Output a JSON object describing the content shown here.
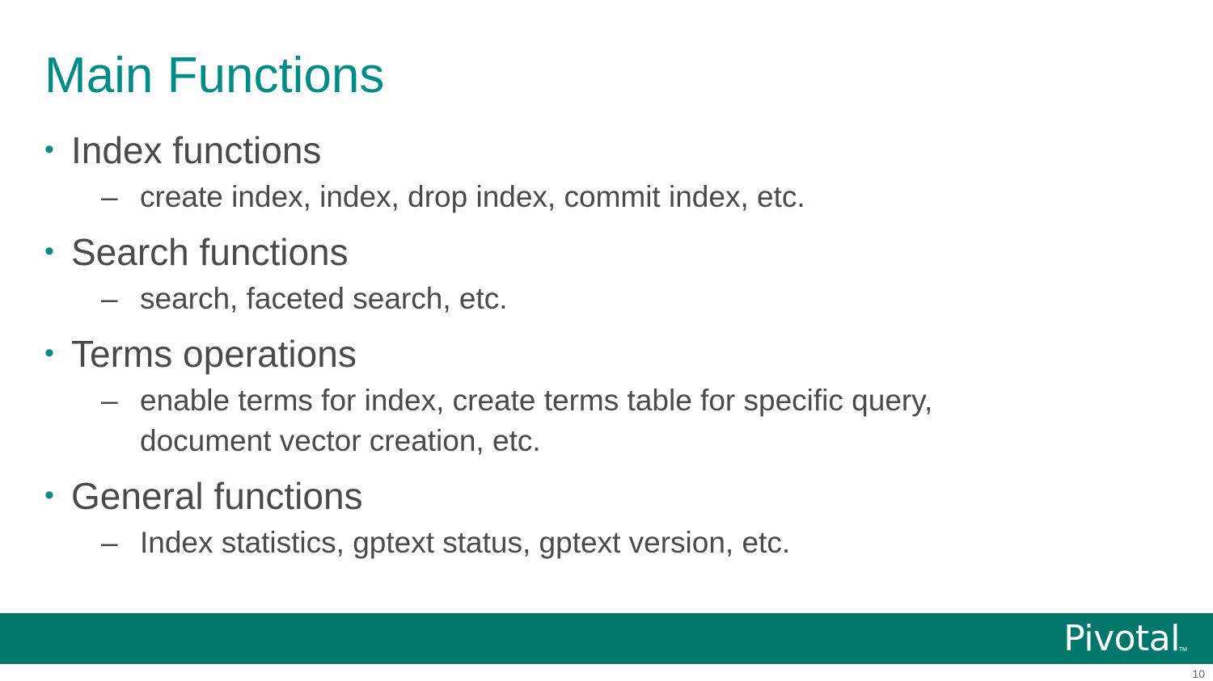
{
  "slide": {
    "title": "Main Functions",
    "bullets": [
      {
        "text": "Index functions",
        "sub": "create index, index, drop index, commit index, etc."
      },
      {
        "text": "Search functions",
        "sub": "search, faceted search, etc."
      },
      {
        "text": "Terms operations",
        "sub": "enable terms for index, create terms table for specific query, document vector creation, etc."
      },
      {
        "text": "General functions",
        "sub": "Index statistics, gptext status, gptext version, etc."
      }
    ],
    "bullet_glyph": "•",
    "dash_glyph": "–"
  },
  "footer": {
    "logo": "Pivotal",
    "logo_tm": "TM",
    "page_number": "10",
    "bar_color": "#01776c"
  },
  "colors": {
    "title": "#008b84",
    "body_text": "#4a4a4a",
    "bullet": "#0f8a82"
  }
}
